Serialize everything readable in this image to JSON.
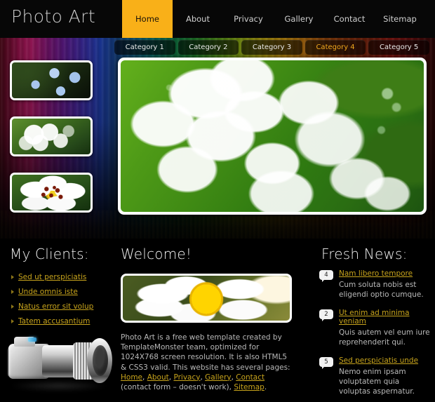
{
  "header": {
    "logo": "Photo Art",
    "nav": [
      {
        "label": "Home",
        "active": true
      },
      {
        "label": "About",
        "active": false
      },
      {
        "label": "Privacy",
        "active": false
      },
      {
        "label": "Gallery",
        "active": false
      },
      {
        "label": "Contact",
        "active": false
      },
      {
        "label": "Sitemap",
        "active": false
      }
    ]
  },
  "categories": [
    {
      "label": "Category 1",
      "highlighted": false
    },
    {
      "label": "Category 2",
      "highlighted": false
    },
    {
      "label": "Category 3",
      "highlighted": false
    },
    {
      "label": "Category 4",
      "highlighted": true
    },
    {
      "label": "Category 5",
      "highlighted": false
    }
  ],
  "sidebar": {
    "thumbnails": [
      {
        "alt": "blue forget-me-not flowers"
      },
      {
        "alt": "white blossom cluster"
      },
      {
        "alt": "white dog rose flower"
      }
    ]
  },
  "hero": {
    "alt": "white blossoms with dew on green leaves"
  },
  "clients": {
    "heading": "My Clients:",
    "links": [
      "Sed ut perspiciatis",
      "Unde omnis iste",
      "Natus error sit volup",
      "Tatem accusantium"
    ]
  },
  "camera": {
    "alt": "silver DSLR camera with telephoto lens"
  },
  "welcome": {
    "heading": "Welcome!",
    "image_alt": "white daisy with yellow center",
    "body_prefix": "Photo Art is a free web template created by TemplateMonster team, optimized for 1024X768 screen resolution. It is also HTML5 & CSS3 valid. This website has several pages: ",
    "links": [
      "Home",
      "About",
      "Privacy",
      "Gallery",
      "Contact"
    ],
    "sep": ", ",
    "after_contact": " (contact form – doesn't work), ",
    "sitemap_link": "Sitemap",
    "body_suffix": "."
  },
  "news": {
    "heading": "Fresh News:",
    "items": [
      {
        "date": "4",
        "title": "Nam libero tempore",
        "text": "Cum soluta nobis est eligendi optio cumque."
      },
      {
        "date": "2",
        "title": "Ut enim ad minima veniam",
        "text": "Quis autem vel eum iure reprehenderit qui."
      },
      {
        "date": "5",
        "title": "Sed perspiciatis unde",
        "text": "Nemo enim ipsam voluptatem quia voluptas aspernatur."
      }
    ]
  },
  "colors": {
    "accent": "#f9b018",
    "link": "#c8a41c",
    "text": "#b9b9b9",
    "heading": "#f2f2f2",
    "background": "#000000"
  }
}
